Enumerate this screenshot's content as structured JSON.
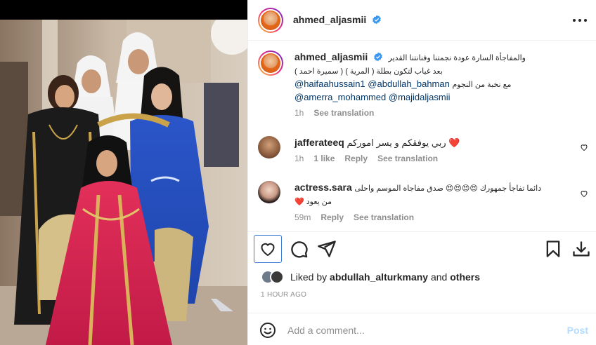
{
  "post": {
    "username": "ahmed_aljasmii",
    "verified": true
  },
  "caption": {
    "username": "ahmed_aljasmii",
    "line1": "والمفاجأة السارة عودة نجمتنا وفنانتنا القدير",
    "line2": "بعد غياب لتكون بطلة ( المرية ) ( سميرة احمد )",
    "mention1": "@haifaahussain1",
    "mention2": "@abdullah_bahman",
    "mid_text": "مع نخبة من النجوم",
    "mention3": "@amerra_mohammed",
    "mention4": "@majidaljasmii",
    "time": "1h",
    "see_translation": "See translation"
  },
  "comments": [
    {
      "username": "jafferateeq",
      "text": "ربي يوفقكم و يسر اموركم",
      "emoji": "❤️",
      "time": "1h",
      "likes": "1 like",
      "reply": "Reply",
      "see_translation": "See translation"
    },
    {
      "username": "actress.sara",
      "text_line1": "دائما تفاجأ جمهورك 😍😍😍😍 صدق مفاجاه الموسم واحلى",
      "text_line2": "من يعود ❤️",
      "time": "59m",
      "reply": "Reply",
      "see_translation": "See translation"
    }
  ],
  "likes": {
    "prefix": "Liked by",
    "user": "abdullah_alturkmany",
    "conj": "and",
    "others": "others"
  },
  "timestamp": "1 HOUR AGO",
  "composer": {
    "placeholder": "Add a comment...",
    "post_label": "Post"
  },
  "icons": {
    "like": "heart-icon",
    "comment": "comment-icon",
    "share": "send-icon",
    "save": "bookmark-icon",
    "download": "download-icon",
    "more": "more-icon",
    "emoji": "emoji-icon"
  },
  "colors": {
    "accent": "#0095f6",
    "post_disabled": "#b3dbff",
    "mention": "#00376b",
    "muted": "#8e8e8e",
    "verified": "#3897f0",
    "heart": "#ed4956"
  }
}
